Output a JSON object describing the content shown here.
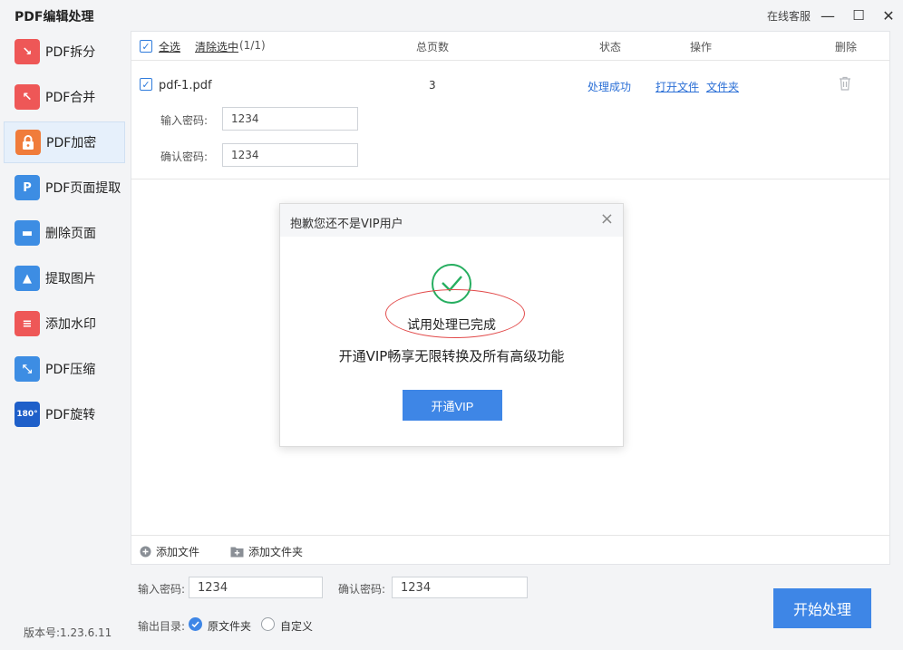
{
  "app": {
    "title": "PDF编辑处理",
    "version": "版本号:1.23.6.11"
  },
  "window_controls": {
    "service": "在线客服",
    "minimize": "—",
    "maximize": "☐",
    "close": "✕"
  },
  "sidebar": {
    "items": [
      {
        "label": "PDF拆分",
        "icon": "split-icon",
        "color": "#ee5757",
        "glyph": "↘"
      },
      {
        "label": "PDF合并",
        "icon": "merge-icon",
        "color": "#ee5757",
        "glyph": "↖"
      },
      {
        "label": "PDF加密",
        "icon": "lock-icon",
        "color": "#f07c3b",
        "glyph": "🔒",
        "active": true
      },
      {
        "label": "PDF页面提取",
        "icon": "page-extract-icon",
        "color": "#3d8de3",
        "glyph": "P"
      },
      {
        "label": "删除页面",
        "icon": "delete-page-icon",
        "color": "#3d8de3",
        "glyph": "▬"
      },
      {
        "label": "提取图片",
        "icon": "extract-image-icon",
        "color": "#3d8de3",
        "glyph": "▲"
      },
      {
        "label": "添加水印",
        "icon": "watermark-icon",
        "color": "#ee5757",
        "glyph": "≡"
      },
      {
        "label": "PDF压缩",
        "icon": "compress-icon",
        "color": "#3d8de3",
        "glyph": "⤡"
      },
      {
        "label": "PDF旋转",
        "icon": "rotate-icon",
        "color": "#1e5fc9",
        "glyph": "180°"
      }
    ]
  },
  "table": {
    "select_all": "全选",
    "clear_selected": "清除选中",
    "selected_count": "(1/1)",
    "headers": {
      "pages": "总页数",
      "status": "状态",
      "actions": "操作",
      "delete": "删除"
    },
    "rows": [
      {
        "filename": "pdf-1.pdf",
        "pages": "3",
        "status": "处理成功",
        "open_file": "打开文件",
        "open_folder": "文件夹",
        "password_label": "输入密码:",
        "password_value": "1234",
        "confirm_label": "确认密码:",
        "confirm_value": "1234"
      }
    ]
  },
  "footer": {
    "add_file": "添加文件",
    "add_folder": "添加文件夹"
  },
  "bottom": {
    "password_label": "输入密码:",
    "password_value": "1234",
    "confirm_label": "确认密码:",
    "confirm_value": "1234",
    "output_label": "输出目录:",
    "option_original": "原文件夹",
    "option_custom": "自定义",
    "start": "开始处理"
  },
  "modal": {
    "title": "抱歉您还不是VIP用户",
    "close": "×",
    "done": "试用处理已完成",
    "desc": "开通VIP畅享无限转换及所有高级功能",
    "button": "开通VIP"
  },
  "colors": {
    "accent": "#3e86e6",
    "link": "#2b6fd6",
    "success": "#27ae60",
    "highlight": "#e24b4b"
  }
}
